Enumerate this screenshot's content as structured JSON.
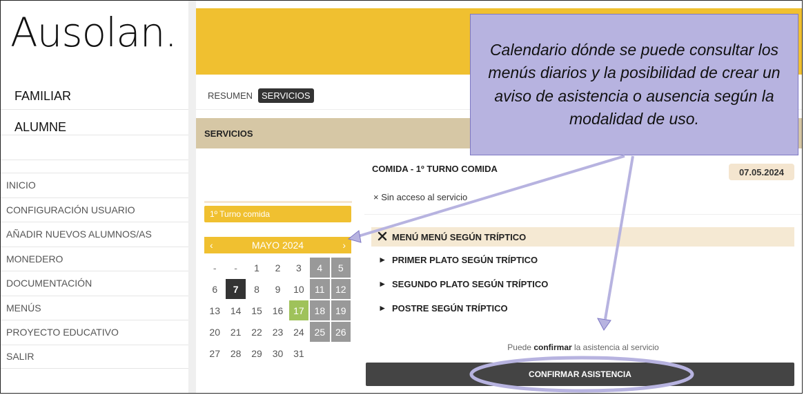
{
  "logo": "Ausolan.",
  "user": {
    "line1": "FAMILIAR",
    "line2": "ALUMNE"
  },
  "nav": [
    "INICIO",
    "CONFIGURACIÓN USUARIO",
    "AÑADIR NUEVOS ALUMNOS/AS",
    "MONEDERO",
    "DOCUMENTACIÓN",
    "MENÚS",
    "PROYECTO EDUCATIVO",
    "SALIR"
  ],
  "tabs": {
    "resumen": "RESUMEN",
    "servicios": "SERVICIOS"
  },
  "section_title": "SERVICIOS",
  "turno": "1º Turno comida",
  "calendar": {
    "month": "MAYO 2024",
    "prev": "‹",
    "next": "›",
    "days": [
      "-",
      "-",
      "1",
      "2",
      "3",
      "4",
      "5",
      "6",
      "7",
      "8",
      "9",
      "10",
      "11",
      "12",
      "13",
      "14",
      "15",
      "16",
      "17",
      "18",
      "19",
      "20",
      "21",
      "22",
      "23",
      "24",
      "25",
      "26",
      "27",
      "28",
      "29",
      "30",
      "31"
    ],
    "today": "7",
    "selected": "17",
    "weekend_columns": [
      5,
      6
    ]
  },
  "detail": {
    "meal_title": "COMIDA - 1º TURNO COMIDA",
    "date": "07.05.2024",
    "access_icon": "×",
    "access_text": "Sin acceso al servicio",
    "menu_head": "MENÚ MENÚ SEGÚN TRÍPTICO",
    "items": [
      "PRIMER PLATO SEGÚN TRÍPTICO",
      "SEGUNDO PLATO SEGÚN TRÍPTICO",
      "POSTRE SEGÚN TRÍPTICO"
    ],
    "confirm_pre": "Puede ",
    "confirm_bold": "confirmar",
    "confirm_post": " la asistencia al servicio",
    "confirm_button": "CONFIRMAR ASISTENCIA"
  },
  "annotation": "Calendario dónde se puede consultar los menús diarios y la posibilidad de crear un aviso de asistencia o ausencia según la modalidad de uso.",
  "colors": {
    "accent": "#f0c030",
    "section": "#d6c7a5",
    "annotation": "#b7b3e0",
    "today": "#333333",
    "selected": "#9fc25a"
  }
}
